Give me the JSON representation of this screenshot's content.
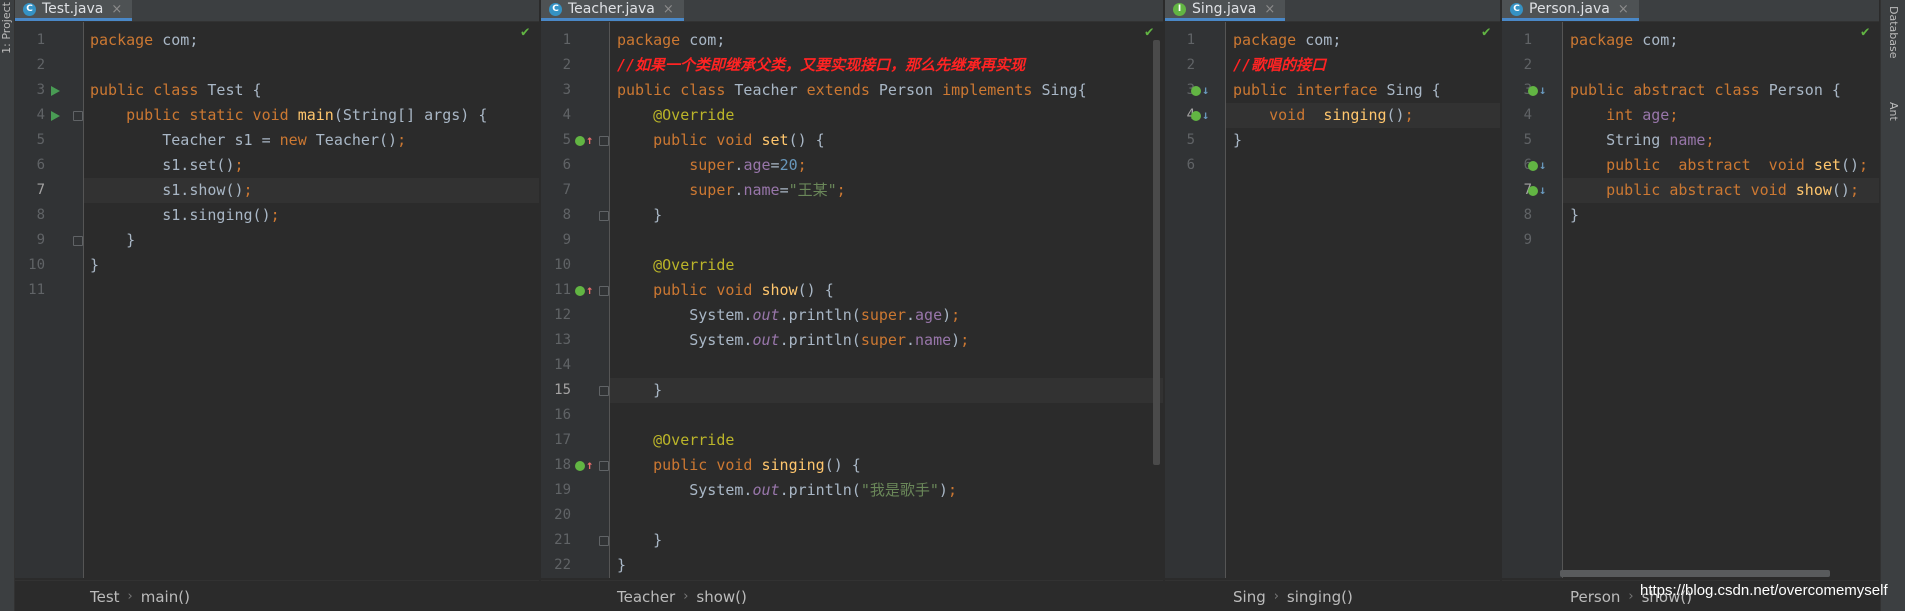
{
  "side": {
    "project_label": "1: Project",
    "database_label": "Database",
    "ant_label": "Ant"
  },
  "watermark": "https://blog.csdn.net/overcomemyself",
  "colors": {
    "background": "#2b2b2b",
    "keyword": "#cc7832",
    "method": "#ffc66d",
    "field": "#9876aa",
    "string": "#6a8759",
    "number": "#6897bb",
    "annotation": "#bbb529",
    "comment": "#ff2323",
    "tab_accent": "#4a88c7"
  },
  "panes": [
    {
      "id": "test",
      "tab_title": "Test.java",
      "tab_icon": "class-icon",
      "icon_glyph": "C",
      "breadcrumb": [
        "Test",
        "main()"
      ],
      "current_line": 7,
      "lines": [
        [
          [
            "kw",
            "package "
          ],
          [
            "t",
            "com;"
          ]
        ],
        [],
        [
          [
            "kw",
            "public class "
          ],
          [
            "t",
            "Test {"
          ]
        ],
        [
          [
            "t",
            "    "
          ],
          [
            "kw",
            "public static void "
          ],
          [
            "fn",
            "main"
          ],
          [
            "t",
            "(String[] args) {"
          ]
        ],
        [
          [
            "t",
            "        Teacher s1 = "
          ],
          [
            "kw",
            "new "
          ],
          [
            "t",
            "Teacher()"
          ],
          [
            "kw",
            ";"
          ]
        ],
        [
          [
            "t",
            "        s1.set()"
          ],
          [
            "kw",
            ";"
          ]
        ],
        [
          [
            "t",
            "        s1.show()"
          ],
          [
            "kw",
            ";"
          ]
        ],
        [
          [
            "t",
            "        s1.singing()"
          ],
          [
            "kw",
            ";"
          ]
        ],
        [
          [
            "t",
            "    }"
          ]
        ],
        [
          [
            "t",
            "}"
          ]
        ],
        []
      ]
    },
    {
      "id": "teacher",
      "tab_title": "Teacher.java",
      "tab_icon": "class-icon",
      "icon_glyph": "C",
      "breadcrumb": [
        "Teacher",
        "show()"
      ],
      "current_line": 15,
      "lines": [
        [
          [
            "kw",
            "package "
          ],
          [
            "t",
            "com;"
          ]
        ],
        [
          [
            "cmt",
            "//如果一个类即继承父类，又要实现接口，那么先继承再实现"
          ]
        ],
        [
          [
            "kw",
            "public class "
          ],
          [
            "t",
            "Teacher "
          ],
          [
            "kw",
            "extends "
          ],
          [
            "t",
            "Person "
          ],
          [
            "kw",
            "implements "
          ],
          [
            "t",
            "Sing{"
          ]
        ],
        [
          [
            "t",
            "    "
          ],
          [
            "ann",
            "@Override"
          ]
        ],
        [
          [
            "t",
            "    "
          ],
          [
            "kw",
            "public void "
          ],
          [
            "fn",
            "set"
          ],
          [
            "t",
            "() {"
          ]
        ],
        [
          [
            "t",
            "        "
          ],
          [
            "kw",
            "super"
          ],
          [
            "t",
            "."
          ],
          [
            "field",
            "age"
          ],
          [
            "t",
            "="
          ],
          [
            "num",
            "20"
          ],
          [
            "kw",
            ";"
          ]
        ],
        [
          [
            "t",
            "        "
          ],
          [
            "kw",
            "super"
          ],
          [
            "t",
            "."
          ],
          [
            "field",
            "name"
          ],
          [
            "t",
            "="
          ],
          [
            "str",
            "\"王某\""
          ],
          [
            "kw",
            ";"
          ]
        ],
        [
          [
            "t",
            "    }"
          ]
        ],
        [],
        [
          [
            "t",
            "    "
          ],
          [
            "ann",
            "@Override"
          ]
        ],
        [
          [
            "t",
            "    "
          ],
          [
            "kw",
            "public void "
          ],
          [
            "fn",
            "show"
          ],
          [
            "t",
            "() {"
          ]
        ],
        [
          [
            "t",
            "        System."
          ],
          [
            "fi",
            "out"
          ],
          [
            "t",
            ".println("
          ],
          [
            "kw",
            "super"
          ],
          [
            "t",
            "."
          ],
          [
            "field",
            "age"
          ],
          [
            "t",
            ")"
          ],
          [
            "kw",
            ";"
          ]
        ],
        [
          [
            "t",
            "        System."
          ],
          [
            "fi",
            "out"
          ],
          [
            "t",
            ".println("
          ],
          [
            "kw",
            "super"
          ],
          [
            "t",
            "."
          ],
          [
            "field",
            "name"
          ],
          [
            "t",
            ")"
          ],
          [
            "kw",
            ";"
          ]
        ],
        [],
        [
          [
            "t",
            "    }"
          ]
        ],
        [],
        [
          [
            "t",
            "    "
          ],
          [
            "ann",
            "@Override"
          ]
        ],
        [
          [
            "t",
            "    "
          ],
          [
            "kw",
            "public void "
          ],
          [
            "fn",
            "singing"
          ],
          [
            "t",
            "() {"
          ]
        ],
        [
          [
            "t",
            "        System."
          ],
          [
            "fi",
            "out"
          ],
          [
            "t",
            ".println("
          ],
          [
            "str",
            "\"我是歌手\""
          ],
          [
            "t",
            ")"
          ],
          [
            "kw",
            ";"
          ]
        ],
        [],
        [
          [
            "t",
            "    }"
          ]
        ],
        [
          [
            "t",
            "}"
          ]
        ]
      ]
    },
    {
      "id": "sing",
      "tab_title": "Sing.java",
      "tab_icon": "interface-icon",
      "icon_glyph": "I",
      "breadcrumb": [
        "Sing",
        "singing()"
      ],
      "current_line": 4,
      "lines": [
        [
          [
            "kw",
            "package "
          ],
          [
            "t",
            "com;"
          ]
        ],
        [
          [
            "cmt",
            "//歌唱的接口"
          ]
        ],
        [
          [
            "kw",
            "public interface "
          ],
          [
            "t",
            "Sing {"
          ]
        ],
        [
          [
            "t",
            "    "
          ],
          [
            "kw",
            "void  "
          ],
          [
            "fn",
            "singing"
          ],
          [
            "t",
            "()"
          ],
          [
            "kw",
            ";"
          ]
        ],
        [
          [
            "t",
            "}"
          ]
        ],
        []
      ]
    },
    {
      "id": "person",
      "tab_title": "Person.java",
      "tab_icon": "abstract-class-icon",
      "icon_glyph": "C",
      "breadcrumb": [
        "Person",
        "show()"
      ],
      "current_line": 7,
      "lines": [
        [
          [
            "kw",
            "package "
          ],
          [
            "t",
            "com;"
          ]
        ],
        [],
        [
          [
            "kw",
            "public abstract class "
          ],
          [
            "t",
            "Person {"
          ]
        ],
        [
          [
            "t",
            "    "
          ],
          [
            "kw",
            "int "
          ],
          [
            "field",
            "age"
          ],
          [
            "kw",
            ";"
          ]
        ],
        [
          [
            "t",
            "    String "
          ],
          [
            "field",
            "name"
          ],
          [
            "kw",
            ";"
          ]
        ],
        [
          [
            "t",
            "    "
          ],
          [
            "kw",
            "public  abstract  void "
          ],
          [
            "fn",
            "set"
          ],
          [
            "t",
            "()"
          ],
          [
            "kw",
            ";"
          ]
        ],
        [
          [
            "t",
            "    "
          ],
          [
            "kw",
            "public abstract void "
          ],
          [
            "fn",
            "show"
          ],
          [
            "t",
            "()"
          ],
          [
            "kw",
            ";"
          ]
        ],
        [
          [
            "t",
            "}"
          ]
        ],
        []
      ]
    }
  ]
}
